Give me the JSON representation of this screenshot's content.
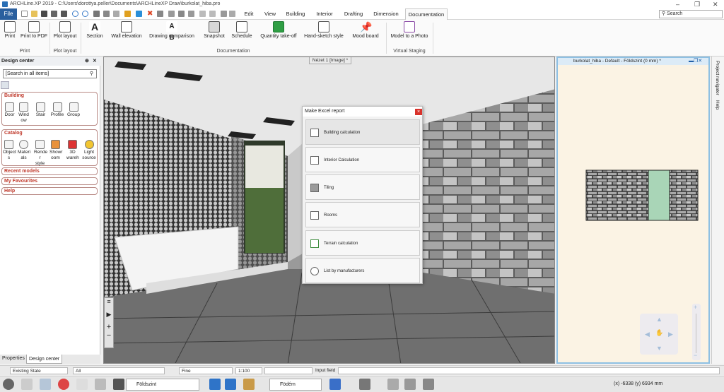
{
  "window": {
    "title": "ARCHLine.XP 2019 - C:\\Users\\dorottya.peller\\Documents\\ARCHLineXP Draw\\burkolat_hiba.pro",
    "controls": [
      "–",
      "❐",
      "✕"
    ]
  },
  "ribbon_tabs": {
    "file": "File",
    "tabs": [
      "Edit",
      "View",
      "Building",
      "Interior",
      "Drafting",
      "Dimension",
      "Documentation"
    ],
    "active": "Documentation",
    "search_placeholder": "Search"
  },
  "ribbon": {
    "buttons": [
      {
        "label": "Print",
        "icon": "printer-icon"
      },
      {
        "label": "Print to PDF",
        "icon": "pdf-printer-icon"
      },
      {
        "label": "Plot layout",
        "icon": "plot-layout-icon"
      },
      {
        "label": "Section",
        "icon": "section-icon"
      },
      {
        "label": "Wall elevation",
        "icon": "wall-elevation-icon"
      },
      {
        "label": "Drawing comparison",
        "icon": "drawing-comparison-icon"
      },
      {
        "label": "Snapshot",
        "icon": "camera-icon"
      },
      {
        "label": "Schedule",
        "icon": "schedule-icon"
      },
      {
        "label": "Quantity take-off",
        "icon": "excel-icon"
      },
      {
        "label": "Hand-sketch style",
        "icon": "hand-sketch-icon"
      },
      {
        "label": "Mood board",
        "icon": "pin-icon"
      },
      {
        "label": "Model to a Photo",
        "icon": "model-to-photo-icon"
      }
    ],
    "groups": [
      "Print",
      "Plot layout",
      "Documentation",
      "Virtual Staging"
    ]
  },
  "design_center": {
    "title": "Design center",
    "search_placeholder": "[Search in all items]",
    "building_title": "Building",
    "building_items": [
      "Door",
      "Wind ow",
      "Stair",
      "Profile",
      "Group"
    ],
    "catalog_title": "Catalog",
    "catalog_items": [
      "Object s",
      "Materi als",
      "Rende r style",
      "Showr oom",
      "3D wareh",
      "Light source"
    ],
    "other_sections": [
      "Recent models",
      "My Favourites",
      "Help"
    ],
    "bottom_tabs": [
      "Properties",
      "Design center"
    ]
  },
  "viewport3d": {
    "title": "Nézet 1 [Image] *"
  },
  "excel_dialog": {
    "title": "Make Excel report",
    "close": "×",
    "items": [
      {
        "label": "Building calculation",
        "icon": "building-icon"
      },
      {
        "label": "Interior Calculation",
        "icon": "chair-icon"
      },
      {
        "label": "Tiling",
        "icon": "tiling-icon"
      },
      {
        "label": "Rooms",
        "icon": "rooms-icon"
      },
      {
        "label": "Terrain calculation",
        "icon": "terrain-icon"
      },
      {
        "label": "List by manufacturers",
        "icon": "manufacturers-icon"
      }
    ]
  },
  "viewport2d": {
    "title": "burkolat_hiba - Default - Földszint (0 mm) *"
  },
  "right_sidebar": [
    "Project navigator",
    "Help"
  ],
  "status_bar": {
    "state": "Existing State",
    "filter": "All",
    "line": "Fine",
    "scale": "1:100",
    "input_label": "Input field"
  },
  "toolbar": {
    "floor": "Földszint",
    "level": "Födém",
    "coords": "(x) -6338  (y) 6934 mm"
  },
  "colors": {
    "accent": "#2a5f9e",
    "tile_green": "#a9d5b7",
    "close_red": "#d9322b",
    "section_red": "#c0392b"
  }
}
